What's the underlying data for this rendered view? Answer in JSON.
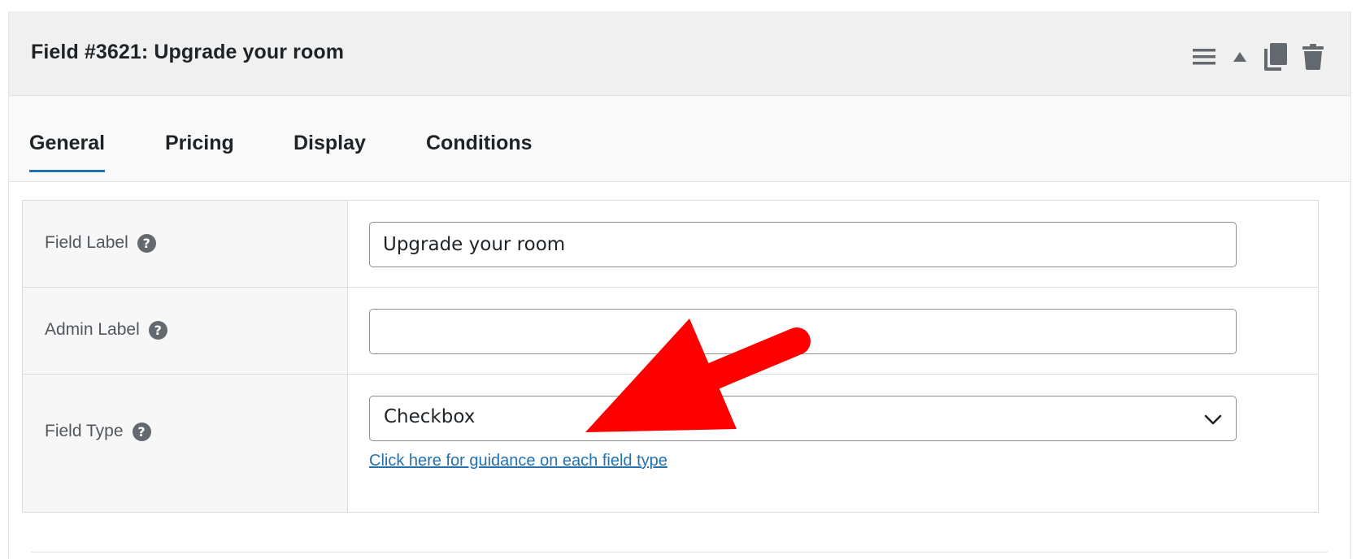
{
  "header": {
    "title": "Field #3621: Upgrade your room",
    "tools": [
      "menu-icon",
      "move-up-icon",
      "duplicate-icon",
      "trash-icon"
    ]
  },
  "tabs": [
    {
      "label": "General",
      "active": true
    },
    {
      "label": "Pricing",
      "active": false
    },
    {
      "label": "Display",
      "active": false
    },
    {
      "label": "Conditions",
      "active": false
    }
  ],
  "form": {
    "field_label": {
      "label": "Field Label",
      "value": "Upgrade your room",
      "placeholder": ""
    },
    "admin_label": {
      "label": "Admin Label",
      "value": "",
      "placeholder": ""
    },
    "field_type": {
      "label": "Field Type",
      "selected": "Checkbox",
      "guide_link": "Click here for guidance on each field type"
    },
    "help_glyph": "?"
  },
  "colors": {
    "accent": "#2271b1",
    "annotation_arrow": "#ff0000",
    "header_bg": "#f0f0f0",
    "help_icon": "#646970"
  }
}
